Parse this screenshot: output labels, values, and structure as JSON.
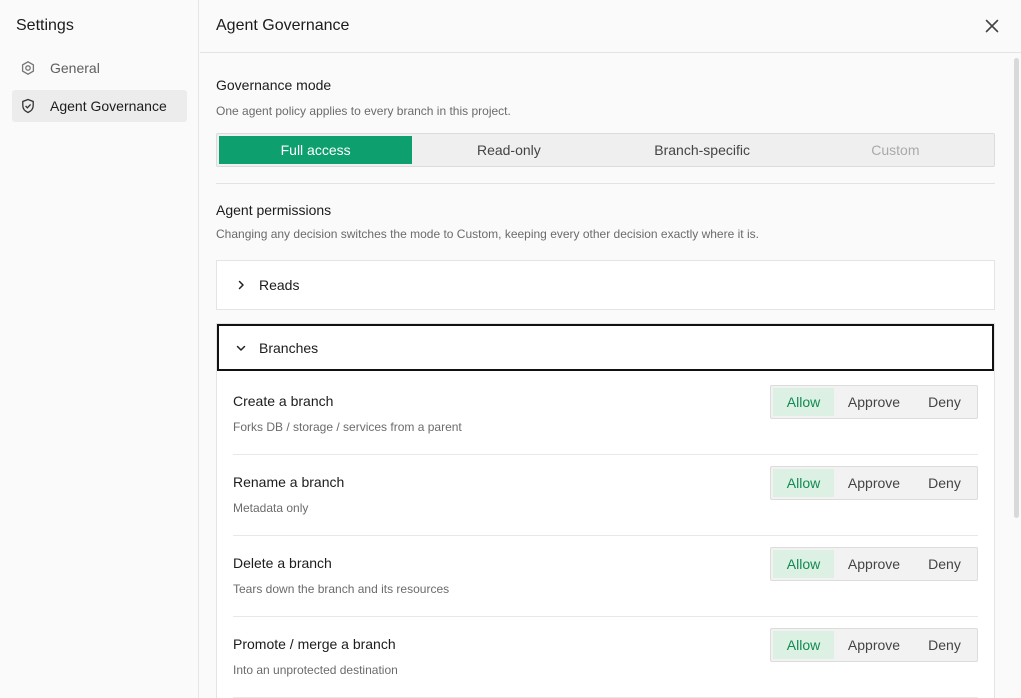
{
  "sidebar": {
    "title": "Settings",
    "items": [
      {
        "label": "General",
        "icon": "gear-icon"
      },
      {
        "label": "Agent Governance",
        "icon": "shield-check-icon",
        "active": true
      }
    ]
  },
  "header": {
    "title": "Agent Governance",
    "close_icon": "close-icon"
  },
  "governance": {
    "title": "Governance mode",
    "description": "One agent policy applies to every branch in this project.",
    "modes": [
      "Full access",
      "Read-only",
      "Branch-specific",
      "Custom"
    ],
    "selected_mode": "Full access"
  },
  "permissions": {
    "title": "Agent permissions",
    "description": "Changing any decision switches the mode to Custom, keeping every other decision exactly where it is.",
    "groups": [
      {
        "label": "Reads",
        "expanded": false
      },
      {
        "label": "Branches",
        "expanded": true
      }
    ],
    "options": [
      "Allow",
      "Approve",
      "Deny"
    ],
    "rows": [
      {
        "title": "Create a branch",
        "description": "Forks DB / storage / services from a parent",
        "decision": "Allow"
      },
      {
        "title": "Rename a branch",
        "description": "Metadata only",
        "decision": "Allow"
      },
      {
        "title": "Delete a branch",
        "description": "Tears down the branch and its resources",
        "decision": "Allow"
      },
      {
        "title": "Promote / merge a branch",
        "description": "Into an unprotected destination",
        "decision": "Allow"
      }
    ]
  },
  "colors": {
    "accent": "#0e9f6e",
    "allow_bg": "#dcf0e3",
    "allow_text": "#128a52"
  }
}
